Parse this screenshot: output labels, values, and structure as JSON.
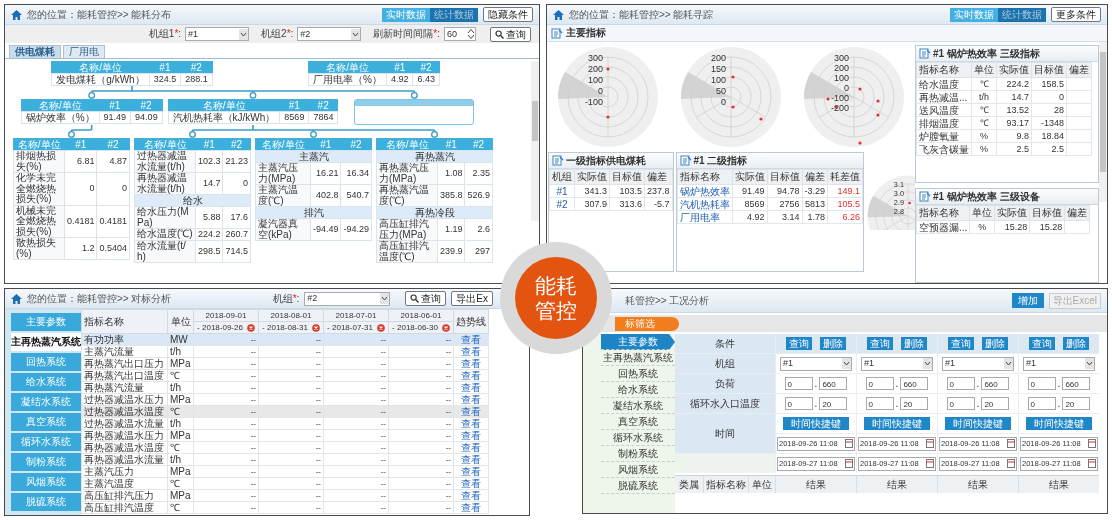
{
  "distribution": {
    "breadcrumb": "您的位置：能耗管控>> 能耗分布",
    "data_modes": [
      {
        "label": "实时数据",
        "selected": true
      },
      {
        "label": "统计数据",
        "selected": false
      }
    ],
    "toggle_button": "隐藏条件",
    "filters": [
      {
        "kind": "select",
        "label": "机组1",
        "star": "*",
        "suffix": ":",
        "value": "#1"
      },
      {
        "kind": "select",
        "label": "机组2",
        "star": "*",
        "suffix": ":",
        "value": "#2"
      },
      {
        "kind": "spinner",
        "label": "刷新时间间隔",
        "star": "*",
        "suffix": ":",
        "value": "60"
      }
    ],
    "query_button": "查询",
    "tabs": [
      {
        "label": "供电煤耗",
        "selected": true
      },
      {
        "label": "厂用电",
        "selected": false
      }
    ],
    "tree": [
      {
        "kind": "table",
        "columns": [
          "名称/单位",
          "#1",
          "#2"
        ],
        "rows": [
          {
            "kind": "data",
            "cells": [
              "发电煤耗（g/kWh）",
              "324.5",
              "288.1"
            ]
          }
        ],
        "children": [
          {
            "kind": "table",
            "columns": [
              "名称/单位",
              "#1",
              "#2"
            ],
            "rows": [
              {
                "kind": "data",
                "cells": [
                  "锅炉效率（%）",
                  "91.49",
                  "94.09"
                ]
              }
            ],
            "children": [
              {
                "kind": "table",
                "columns": [
                  "名称/单位",
                  "#1",
                  "#2"
                ],
                "rows": [
                  {
                    "kind": "data",
                    "cells": [
                      "排烟热损失(%)",
                      "6.81",
                      "4.87"
                    ]
                  },
                  {
                    "kind": "data",
                    "cells": [
                      "化学未完全燃烧热损失(%)",
                      "0",
                      "0"
                    ]
                  },
                  {
                    "kind": "data",
                    "cells": [
                      "机械未完全燃烧热损失(%)",
                      "0.4181",
                      "0.4181"
                    ]
                  },
                  {
                    "kind": "data",
                    "cells": [
                      "散热损失(%)",
                      "1.2",
                      "0.5404"
                    ]
                  }
                ]
              }
            ]
          },
          {
            "kind": "table",
            "columns": [
              "名称/单位",
              "#1",
              "#2"
            ],
            "rows": [
              {
                "kind": "data",
                "cells": [
                  "汽机热耗率（kJ/kWh）",
                  "8569",
                  "7864"
                ]
              }
            ],
            "children": [
              {
                "kind": "table",
                "columns": [
                  "名称/单位",
                  "#1",
                  "#2"
                ],
                "rows": [
                  {
                    "kind": "data",
                    "cells": [
                      "过热器减温水流量(t/h)",
                      "102.3",
                      "21.23"
                    ]
                  },
                  {
                    "kind": "data",
                    "cells": [
                      "再热器减温水流量(t/h)",
                      "14.7",
                      "0"
                    ]
                  },
                  {
                    "kind": "section",
                    "label": "给水"
                  },
                  {
                    "kind": "data",
                    "cells": [
                      "给水压力(MPa)",
                      "5.88",
                      "17.6"
                    ]
                  },
                  {
                    "kind": "data",
                    "cells": [
                      "给水温度(℃)",
                      "224.2",
                      "260.7"
                    ]
                  },
                  {
                    "kind": "data",
                    "cells": [
                      "给水流量(t/h)",
                      "298.5",
                      "714.5"
                    ]
                  }
                ]
              },
              {
                "kind": "table",
                "columns": [
                  "名称/单位",
                  "#1",
                  "#2"
                ],
                "rows": [
                  {
                    "kind": "section",
                    "label": "主蒸汽"
                  },
                  {
                    "kind": "data",
                    "cells": [
                      "主蒸汽压力(MPa)",
                      "16.21",
                      "16.34"
                    ]
                  },
                  {
                    "kind": "data",
                    "cells": [
                      "主蒸汽温度(℃)",
                      "402.8",
                      "540.7"
                    ]
                  },
                  {
                    "kind": "section",
                    "label": "排汽"
                  },
                  {
                    "kind": "data",
                    "cells": [
                      "凝汽器真空(kPa)",
                      "-94.49",
                      "-94.29"
                    ]
                  }
                ]
              },
              {
                "kind": "table",
                "columns": [
                  "名称/单位",
                  "#1",
                  "#2"
                ],
                "rows": [
                  {
                    "kind": "section",
                    "label": "再热蒸汽"
                  },
                  {
                    "kind": "data",
                    "cells": [
                      "再热蒸汽压力(MPa)",
                      "1.08",
                      "2.35"
                    ]
                  },
                  {
                    "kind": "data",
                    "cells": [
                      "再热蒸汽温度(℃)",
                      "385.8",
                      "526.9"
                    ]
                  },
                  {
                    "kind": "section",
                    "label": "再热冷段"
                  },
                  {
                    "kind": "data",
                    "cells": [
                      "高压缸排汽压力(MPa)",
                      "1.19",
                      "2.6"
                    ]
                  },
                  {
                    "kind": "data",
                    "cells": [
                      "高压缸排汽温度(℃)",
                      "239.9",
                      "297"
                    ]
                  }
                ]
              }
            ]
          },
          {
            "kind": "blank"
          }
        ]
      },
      {
        "kind": "table",
        "columns": [
          "名称/单位",
          "#1",
          "#2"
        ],
        "rows": [
          {
            "kind": "data",
            "cells": [
              "厂用电率（%）",
              "4.92",
              "6.43"
            ]
          }
        ]
      }
    ]
  },
  "tracking": {
    "breadcrumb": "您的位置：能耗管控>> 能耗寻踪",
    "data_modes": [
      {
        "label": "实时数据",
        "selected": true
      },
      {
        "label": "统计数据",
        "selected": false
      }
    ],
    "more_button": "更多条件",
    "section_title": "主要指标",
    "polar_charts": [
      {
        "ticks": [
          "300",
          "200",
          "100",
          "0",
          "-100"
        ]
      },
      {
        "ticks": [
          "200",
          "150",
          "100",
          "50",
          "0"
        ]
      },
      {
        "ticks": [
          "300",
          "200",
          "100",
          "0",
          "-100",
          "-200"
        ]
      },
      {
        "ticks": [
          "3.1",
          "3.0",
          "2.9",
          "2.8"
        ]
      }
    ],
    "level1": {
      "kind": "unit_summary",
      "title": "一级指标供电煤耗",
      "columns": [
        "机组",
        "实际值",
        "目标值",
        "偏差"
      ],
      "rows": [
        {
          "cells": [
            "#1",
            "341.3",
            "103.5",
            "237.8"
          ]
        },
        {
          "cells": [
            "#2",
            "307.9",
            "313.6",
            "-5.7"
          ]
        }
      ]
    },
    "level2": {
      "kind": "secondary",
      "title": "#1 二级指标",
      "columns": [
        "指标名称",
        "实际值",
        "目标值",
        "偏差",
        "耗差值"
      ],
      "rows": [
        {
          "cells": [
            "锅炉热效率",
            "91.49",
            "94.78",
            "-3.29",
            "149.1"
          ]
        },
        {
          "cells": [
            "汽机热耗率",
            "8569",
            "2756",
            "5813",
            "105.5"
          ]
        },
        {
          "cells": [
            "厂用电率",
            "4.92",
            "3.14",
            "1.78",
            "6.26"
          ]
        }
      ]
    },
    "level3_indicators": {
      "kind": "tertiary",
      "title": "#1 锅炉热效率 三级指标",
      "columns": [
        "指标名称",
        "单位",
        "实际值",
        "目标值",
        "偏差"
      ],
      "rows": [
        {
          "cells": [
            "给水温度",
            "℃",
            "224.2",
            "158.5"
          ]
        },
        {
          "cells": [
            "再热减温...",
            "t/h",
            "14.7",
            "0"
          ]
        },
        {
          "cells": [
            "送风温度",
            "℃",
            "13.52",
            "28"
          ]
        },
        {
          "cells": [
            "排烟温度",
            "℃",
            "93.17",
            "-1348"
          ]
        },
        {
          "cells": [
            "炉膛氧量",
            "%",
            "9.8",
            "18.84"
          ]
        },
        {
          "cells": [
            "飞灰含碳量",
            "%",
            "2.5",
            "2.5"
          ]
        }
      ]
    },
    "level3_devices": {
      "kind": "tertiary",
      "title": "#1 锅炉热效率 三级设备",
      "columns": [
        "指标名称",
        "单位",
        "实际值",
        "目标值",
        "偏差"
      ],
      "rows": [
        {
          "cells": [
            "空预器漏...",
            "%",
            "15.28",
            "15.28"
          ]
        }
      ]
    }
  },
  "benchmark": {
    "breadcrumb": "您的位置：能耗管控>> 对标分析",
    "unit": {
      "label": "机组",
      "star": "*",
      "suffix": ":",
      "value": "#2"
    },
    "query_button": "查询",
    "export_button": "导出Ex",
    "nav": [
      {
        "label": "主要参数",
        "selected": false
      },
      {
        "label": "主再热蒸汽系统",
        "selected": true
      },
      {
        "label": "回热系统",
        "selected": false
      },
      {
        "label": "给水系统",
        "selected": false
      },
      {
        "label": "凝结水系统",
        "selected": false
      },
      {
        "label": "真空系统",
        "selected": false
      },
      {
        "label": "循环水系统",
        "selected": false
      },
      {
        "label": "制粉系统",
        "selected": false
      },
      {
        "label": "风烟系统",
        "selected": false
      },
      {
        "label": "脱硫系统",
        "selected": false
      }
    ],
    "columns": {
      "name": "指标名称",
      "unit": "单位",
      "periods": [
        {
          "start": "2018-09-01",
          "end": "- 2018-09-26"
        },
        {
          "start": "2018-08-01",
          "end": "- 2018-08-31"
        },
        {
          "start": "2018-07-01",
          "end": "- 2018-07-31"
        },
        {
          "start": "2018-06-01",
          "end": "- 2018-06-30"
        }
      ],
      "trend": "趋势线"
    },
    "rows": [
      {
        "name": "有功功率",
        "unit": "MW",
        "values": [
          "--",
          "--",
          "--",
          "--"
        ],
        "link": "查看",
        "selected": true,
        "hovered": false
      },
      {
        "name": "主蒸汽流量",
        "unit": "t/h",
        "values": [
          "--",
          "--",
          "--",
          "--"
        ],
        "link": "查看",
        "selected": false,
        "hovered": false
      },
      {
        "name": "再热蒸汽出口压力",
        "unit": "MPa",
        "values": [
          "--",
          "--",
          "--",
          "--"
        ],
        "link": "查看",
        "selected": false,
        "hovered": false
      },
      {
        "name": "再热蒸汽出口温度",
        "unit": "℃",
        "values": [
          "--",
          "--",
          "--",
          "--"
        ],
        "link": "查看",
        "selected": false,
        "hovered": false
      },
      {
        "name": "再热蒸汽流量",
        "unit": "t/h",
        "values": [
          "--",
          "--",
          "--",
          "--"
        ],
        "link": "查看",
        "selected": false,
        "hovered": false
      },
      {
        "name": "过热器减温水压力",
        "unit": "MPa",
        "values": [
          "--",
          "--",
          "--",
          "--"
        ],
        "link": "查看",
        "selected": false,
        "hovered": false
      },
      {
        "name": "过热器减温水温度",
        "unit": "℃",
        "values": [
          "--",
          "--",
          "--",
          "--"
        ],
        "link": "查看",
        "selected": false,
        "hovered": true
      },
      {
        "name": "过热器减温水流量",
        "unit": "t/h",
        "values": [
          "--",
          "--",
          "--",
          "--"
        ],
        "link": "查看",
        "selected": false,
        "hovered": false
      },
      {
        "name": "再热器减温水压力",
        "unit": "MPa",
        "values": [
          "--",
          "--",
          "--",
          "--"
        ],
        "link": "查看",
        "selected": false,
        "hovered": false
      },
      {
        "name": "再热器减温水温度",
        "unit": "℃",
        "values": [
          "--",
          "--",
          "--",
          "--"
        ],
        "link": "查看",
        "selected": false,
        "hovered": false
      },
      {
        "name": "再热器减温水流量",
        "unit": "t/h",
        "values": [
          "--",
          "--",
          "--",
          "--"
        ],
        "link": "查看",
        "selected": false,
        "hovered": false
      },
      {
        "name": "主蒸汽压力",
        "unit": "MPa",
        "values": [
          "--",
          "--",
          "--",
          "--"
        ],
        "link": "查看",
        "selected": false,
        "hovered": false
      },
      {
        "name": "主蒸汽温度",
        "unit": "℃",
        "values": [
          "--",
          "--",
          "--",
          "--"
        ],
        "link": "查看",
        "selected": false,
        "hovered": false
      },
      {
        "name": "高压缸排汽压力",
        "unit": "MPa",
        "values": [
          "--",
          "--",
          "--",
          "--"
        ],
        "link": "查看",
        "selected": false,
        "hovered": false
      },
      {
        "name": "高压缸排汽温度",
        "unit": "℃",
        "values": [
          "--",
          "--",
          "--",
          "--"
        ],
        "link": "查看",
        "selected": false,
        "hovered": false
      }
    ]
  },
  "condition": {
    "breadcrumb": "耗管控>> 工况分析",
    "add_button": "增加",
    "export_button": {
      "label": "导出Excel",
      "disabled": true
    },
    "filter_tab": "标筛选",
    "nav": [
      {
        "label": "主要参数",
        "selected": true
      },
      {
        "label": "主再热蒸汽系统",
        "selected": false
      },
      {
        "label": "回热系统",
        "selected": false
      },
      {
        "label": "给水系统",
        "selected": false
      },
      {
        "label": "凝结水系统",
        "selected": false
      },
      {
        "label": "真空系统",
        "selected": false
      },
      {
        "label": "循环水系统",
        "selected": false
      },
      {
        "label": "制粉系统",
        "selected": false
      },
      {
        "label": "风烟系统",
        "selected": false
      },
      {
        "label": "脱硫系统",
        "selected": false
      }
    ],
    "labels": {
      "condition": "条件",
      "unit": "机组",
      "load": "负荷",
      "inlet_temp": "循环水入口温度",
      "time": "时间"
    },
    "columns": [
      {
        "query": "查询",
        "delete": "删除",
        "unit": "#1",
        "load_min": "0",
        "load_sep": ".",
        "load_max": "660",
        "temp_min": "0",
        "temp_sep": ".",
        "temp_max": "20",
        "shortcut": "时间快捷键",
        "start": "2018-09-26 11:08",
        "end": "2018-09-27 11:08"
      },
      {
        "query": "查询",
        "delete": "删除",
        "unit": "#1",
        "load_min": "0",
        "load_sep": ".",
        "load_max": "660",
        "temp_min": "0",
        "temp_sep": ".",
        "temp_max": "20",
        "shortcut": "时间快捷键",
        "start": "2018-09-26 11:08",
        "end": "2018-09-27 11:08"
      },
      {
        "query": "查询",
        "delete": "删除",
        "unit": "#1",
        "load_min": "0",
        "load_sep": ".",
        "load_max": "660",
        "temp_min": "0",
        "temp_sep": ".",
        "temp_max": "20",
        "shortcut": "时间快捷键",
        "start": "2018-09-26 11:08",
        "end": "2018-09-27 11:08"
      },
      {
        "query": "查询",
        "delete": "删除",
        "unit": "#1",
        "load_min": "0",
        "load_sep": ".",
        "load_max": "660",
        "temp_min": "0",
        "temp_sep": ".",
        "temp_max": "20",
        "shortcut": "时间快捷键",
        "start": "2018-09-26 11:08",
        "end": "2018-09-27 11:08"
      }
    ],
    "result_columns": [
      "类属",
      "指标名称",
      "单位",
      "结果",
      "结果",
      "结果",
      "结果"
    ]
  },
  "badge": {
    "lines": [
      "能耗",
      "管控"
    ]
  }
}
